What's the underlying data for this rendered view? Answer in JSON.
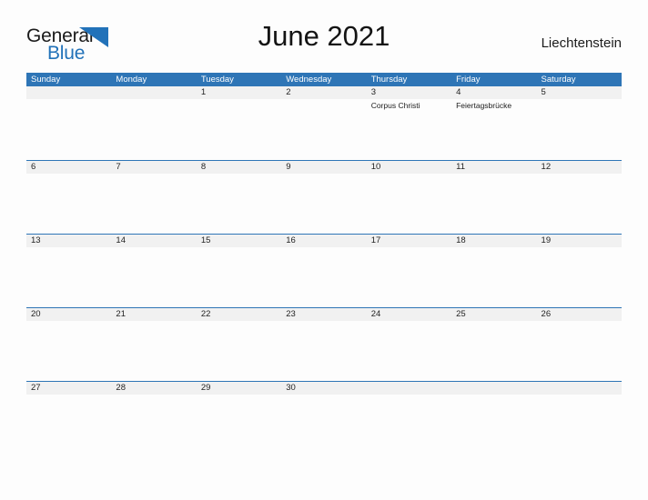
{
  "brand": {
    "name_part1": "General",
    "name_part2": "Blue",
    "flag_icon": "triangle-flag-icon",
    "color_blue": "#2272b9",
    "color_black": "#1b1b1b"
  },
  "header": {
    "title": "June 2021",
    "country": "Liechtenstein"
  },
  "colors": {
    "header_blue": "#2e75b6",
    "row_band_gray": "#f1f1f1",
    "page_background": "#fdfdfd",
    "text": "#232323"
  },
  "calendar": {
    "month": "June",
    "year": "2021",
    "weekday_headers": [
      "Sunday",
      "Monday",
      "Tuesday",
      "Wednesday",
      "Thursday",
      "Friday",
      "Saturday"
    ],
    "weeks": [
      {
        "days": [
          {
            "num": "",
            "events": []
          },
          {
            "num": "",
            "events": []
          },
          {
            "num": "1",
            "events": []
          },
          {
            "num": "2",
            "events": []
          },
          {
            "num": "3",
            "events": [
              "Corpus Christi"
            ]
          },
          {
            "num": "4",
            "events": [
              "Feiertagsbrücke"
            ]
          },
          {
            "num": "5",
            "events": []
          }
        ]
      },
      {
        "days": [
          {
            "num": "6",
            "events": []
          },
          {
            "num": "7",
            "events": []
          },
          {
            "num": "8",
            "events": []
          },
          {
            "num": "9",
            "events": []
          },
          {
            "num": "10",
            "events": []
          },
          {
            "num": "11",
            "events": []
          },
          {
            "num": "12",
            "events": []
          }
        ]
      },
      {
        "days": [
          {
            "num": "13",
            "events": []
          },
          {
            "num": "14",
            "events": []
          },
          {
            "num": "15",
            "events": []
          },
          {
            "num": "16",
            "events": []
          },
          {
            "num": "17",
            "events": []
          },
          {
            "num": "18",
            "events": []
          },
          {
            "num": "19",
            "events": []
          }
        ]
      },
      {
        "days": [
          {
            "num": "20",
            "events": []
          },
          {
            "num": "21",
            "events": []
          },
          {
            "num": "22",
            "events": []
          },
          {
            "num": "23",
            "events": []
          },
          {
            "num": "24",
            "events": []
          },
          {
            "num": "25",
            "events": []
          },
          {
            "num": "26",
            "events": []
          }
        ]
      },
      {
        "days": [
          {
            "num": "27",
            "events": []
          },
          {
            "num": "28",
            "events": []
          },
          {
            "num": "29",
            "events": []
          },
          {
            "num": "30",
            "events": []
          },
          {
            "num": "",
            "events": []
          },
          {
            "num": "",
            "events": []
          },
          {
            "num": "",
            "events": []
          }
        ]
      }
    ]
  }
}
